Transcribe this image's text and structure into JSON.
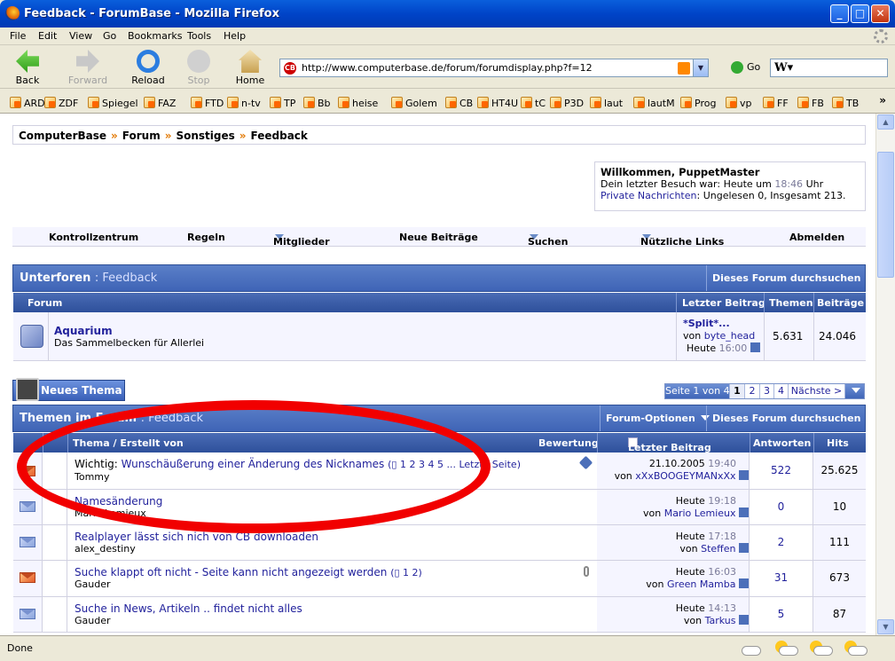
{
  "window": {
    "title": "Feedback - ForumBase - Mozilla Firefox",
    "min": "_",
    "max": "□",
    "close": "✕"
  },
  "menu": [
    "File",
    "Edit",
    "View",
    "Go",
    "Bookmarks",
    "Tools",
    "Help"
  ],
  "nav": {
    "back": "Back",
    "forward": "Forward",
    "reload": "Reload",
    "stop": "Stop",
    "home": "Home",
    "go": "Go"
  },
  "address": {
    "url": "http://www.computerbase.de/forum/forumdisplay.php?f=12"
  },
  "bookmarks": [
    "ARD",
    "ZDF",
    "Spiegel",
    "FAZ",
    "FTD",
    "n-tv",
    "TP",
    "Bb",
    "heise",
    "Golem",
    "CB",
    "HT4U",
    "tC",
    "P3D",
    "laut",
    "lautM",
    "Prog",
    "vp",
    "FF",
    "FB",
    "TB"
  ],
  "bookmarks_more": "»",
  "breadcrumb": [
    "ComputerBase",
    "Forum",
    "Sonstiges",
    "Feedback"
  ],
  "breadcrumb_sep": "»",
  "welcome": {
    "title": "Willkommen, PuppetMaster",
    "last_visit_prefix": "Dein letzter Besuch war: Heute um",
    "last_visit_time": "18:46",
    "last_visit_suffix": "Uhr",
    "pm_link": "Private Nachrichten",
    "pm_text": ": Ungelesen 0, Insgesamt 213."
  },
  "topnav": [
    "Kontrollzentrum",
    "Regeln",
    "Mitglieder",
    "Neue Beiträge",
    "Suchen",
    "Nützliche Links",
    "Abmelden"
  ],
  "subforums": {
    "title": "Unterforen",
    "sub": ": Feedback",
    "search_btn": "Dieses Forum durchsuchen",
    "cols": [
      "Forum",
      "Letzter Beitrag",
      "Themen",
      "Beiträge"
    ],
    "rows": [
      {
        "name": "Aquarium",
        "desc": "Das Sammelbecken für Allerlei",
        "last_title": "*Split*...",
        "last_by_prefix": "von",
        "last_by": "byte_head",
        "last_day": "Heute",
        "last_time": "16:00",
        "threads": "5.631",
        "posts": "24.046"
      }
    ]
  },
  "new_topic": "Neues Thema",
  "pager": {
    "label": "Seite 1 von 4",
    "pages": [
      "1",
      "2",
      "3",
      "4"
    ],
    "next": "Nächste >"
  },
  "threads": {
    "title": "Themen im Forum",
    "sub": ": Feedback",
    "options_btn": "Forum-Optionen",
    "search_btn": "Dieses Forum durchsuchen",
    "cols": {
      "topic": "Thema / Erstellt von",
      "rating": "Bewertung",
      "last": "Letzter Beitrag",
      "replies": "Antworten",
      "hits": "Hits"
    },
    "rows": [
      {
        "prefix": "Wichtig:",
        "title": "Wunschäußerung einer Änderung des Nicknames",
        "pages": "(▯ 1 2 3 4 5 ... Letzte Seite)",
        "author": "Tommy",
        "date": "21.10.2005",
        "time": "19:40",
        "by": "xXxBOOGEYMANxXx",
        "replies": "522",
        "hits": "25.625",
        "hot": true
      },
      {
        "prefix": "",
        "title": "Namesänderung",
        "pages": "",
        "author": "Mario Lemieux",
        "date": "Heute",
        "time": "19:18",
        "by": "Mario Lemieux",
        "replies": "0",
        "hits": "10",
        "hot": false
      },
      {
        "prefix": "",
        "title": "Realplayer lässt sich nich von CB downloaden",
        "pages": "",
        "author": "alex_destiny",
        "date": "Heute",
        "time": "17:18",
        "by": "Steffen",
        "replies": "2",
        "hits": "111",
        "hot": false
      },
      {
        "prefix": "",
        "title": "Suche klappt oft nicht - Seite kann nicht angezeigt werden",
        "pages": "(▯ 1 2)",
        "author": "Gauder",
        "date": "Heute",
        "time": "16:03",
        "by": "Green Mamba",
        "replies": "31",
        "hits": "673",
        "hot": true
      },
      {
        "prefix": "",
        "title": "Suche in News, Artikeln .. findet nicht alles",
        "pages": "",
        "author": "Gauder",
        "date": "Heute",
        "time": "14:13",
        "by": "Tarkus",
        "replies": "5",
        "hits": "87",
        "hot": false
      }
    ],
    "by_prefix": "von"
  },
  "status": "Done",
  "colors": {
    "accent": "#3f64b6",
    "link": "#22229c",
    "annotation": "#f10000"
  }
}
